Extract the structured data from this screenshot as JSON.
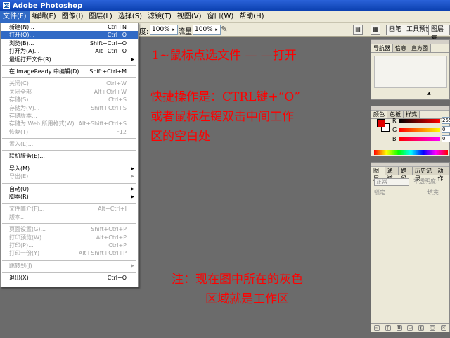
{
  "window": {
    "title": "Adobe Photoshop",
    "app_icon": "Ps"
  },
  "menubar": [
    {
      "label": "文件(F)"
    },
    {
      "label": "编辑(E)"
    },
    {
      "label": "图像(I)"
    },
    {
      "label": "图层(L)"
    },
    {
      "label": "选择(S)"
    },
    {
      "label": "滤镜(T)"
    },
    {
      "label": "视图(V)"
    },
    {
      "label": "窗口(W)"
    },
    {
      "label": "帮助(H)"
    }
  ],
  "options_bar": {
    "opacity_label": "度:",
    "opacity_value": "100%",
    "flow_label": "流量:",
    "flow_value": "100%",
    "palette_well_tabs": [
      "画笔",
      "工具预设",
      "图层复"
    ]
  },
  "file_menu": [
    {
      "label": "新建(N)...",
      "shortcut": "Ctrl+N",
      "state": "normal"
    },
    {
      "label": "打开(O)...",
      "shortcut": "Ctrl+O",
      "state": "highlighted"
    },
    {
      "label": "浏览(B)...",
      "shortcut": "Shift+Ctrl+O",
      "state": "normal"
    },
    {
      "label": "打开为(A)...",
      "shortcut": "Alt+Ctrl+O",
      "state": "normal"
    },
    {
      "label": "最近打开文件(R)",
      "shortcut": "",
      "state": "submenu"
    },
    {
      "sep": true
    },
    {
      "label": "在 ImageReady 中编辑(D)",
      "shortcut": "Shift+Ctrl+M",
      "state": "normal"
    },
    {
      "sep": true
    },
    {
      "label": "关闭(C)",
      "shortcut": "Ctrl+W",
      "state": "disabled"
    },
    {
      "label": "关闭全部",
      "shortcut": "Alt+Ctrl+W",
      "state": "disabled"
    },
    {
      "label": "存储(S)",
      "shortcut": "Ctrl+S",
      "state": "disabled"
    },
    {
      "label": "存储为(V)...",
      "shortcut": "Shift+Ctrl+S",
      "state": "disabled"
    },
    {
      "label": "存储版本...",
      "shortcut": "",
      "state": "disabled"
    },
    {
      "label": "存储为 Web 所用格式(W)...",
      "shortcut": "Alt+Shift+Ctrl+S",
      "state": "disabled"
    },
    {
      "label": "恢复(T)",
      "shortcut": "F12",
      "state": "disabled"
    },
    {
      "sep": true
    },
    {
      "label": "置入(L)...",
      "shortcut": "",
      "state": "disabled"
    },
    {
      "sep": true
    },
    {
      "label": "联机服务(E)...",
      "shortcut": "",
      "state": "normal"
    },
    {
      "sep": true
    },
    {
      "label": "导入(M)",
      "shortcut": "",
      "state": "submenu"
    },
    {
      "label": "导出(E)",
      "shortcut": "",
      "state": "submenu-disabled"
    },
    {
      "sep": true
    },
    {
      "label": "自动(U)",
      "shortcut": "",
      "state": "submenu"
    },
    {
      "label": "脚本(R)",
      "shortcut": "",
      "state": "submenu"
    },
    {
      "sep": true
    },
    {
      "label": "文件简介(F)...",
      "shortcut": "Alt+Ctrl+I",
      "state": "disabled"
    },
    {
      "label": "版本...",
      "shortcut": "",
      "state": "disabled"
    },
    {
      "sep": true
    },
    {
      "label": "页面设置(G)...",
      "shortcut": "Shift+Ctrl+P",
      "state": "disabled"
    },
    {
      "label": "打印预览(W)...",
      "shortcut": "Alt+Ctrl+P",
      "state": "disabled"
    },
    {
      "label": "打印(P)...",
      "shortcut": "Ctrl+P",
      "state": "disabled"
    },
    {
      "label": "打印一份(Y)",
      "shortcut": "Alt+Shift+Ctrl+P",
      "state": "disabled"
    },
    {
      "sep": true
    },
    {
      "label": "跳转到(J)",
      "shortcut": "",
      "state": "submenu-disabled"
    },
    {
      "sep": true
    },
    {
      "label": "退出(X)",
      "shortcut": "Ctrl+Q",
      "state": "normal"
    }
  ],
  "annotations": {
    "line1": "1~鼠标点选文件 — —打开",
    "line2": "快捷操作是：CTRL键+“O”",
    "line3": "或者鼠标左键双击中间工作",
    "line4": "区的空白处",
    "line5": "注：现在图中所在的灰色",
    "line6": "区域就是工作区"
  },
  "navigator_palette": {
    "tabs": [
      "导航器",
      "信息",
      "直方图"
    ]
  },
  "color_palette": {
    "tabs": [
      "颜色",
      "色板",
      "样式"
    ],
    "foreground": "#e00000",
    "channels": [
      {
        "name": "R",
        "value": "255"
      },
      {
        "name": "G",
        "value": "0"
      },
      {
        "name": "B",
        "value": "0"
      }
    ]
  },
  "layers_palette": {
    "tabs": [
      "图层",
      "通道",
      "路径",
      "历史记录",
      "动作"
    ],
    "blend_mode": "正常",
    "opacity_label": "不透明度:",
    "lock_label": "锁定:",
    "fill_label": "填充:"
  }
}
